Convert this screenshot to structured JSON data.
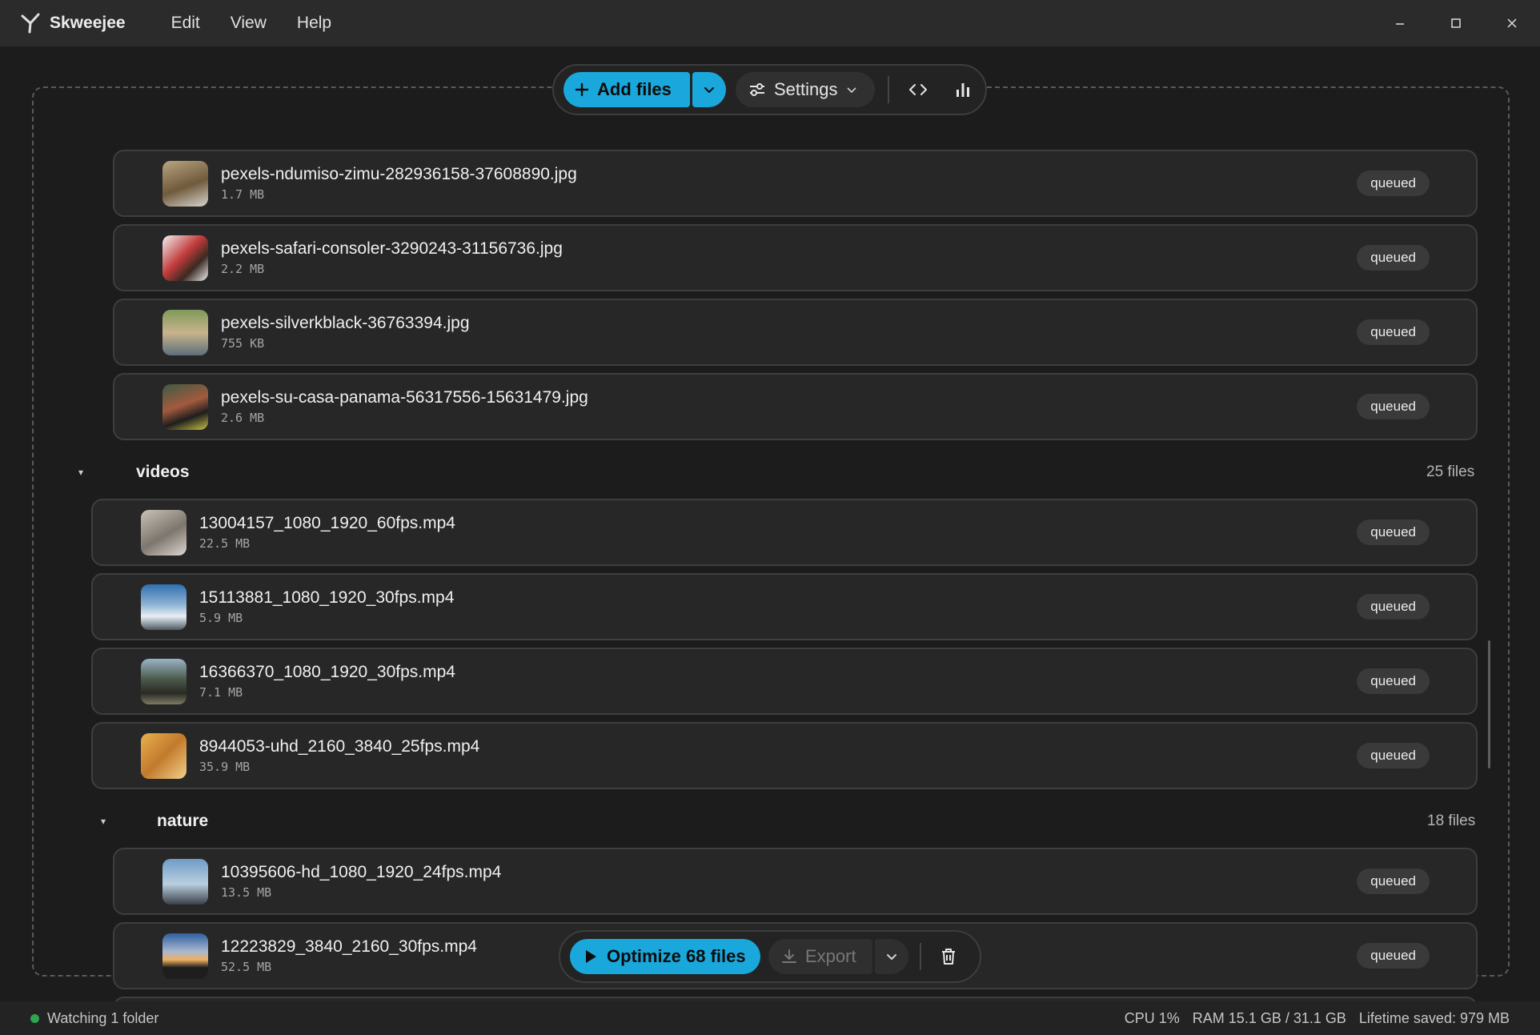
{
  "app": {
    "name": "Skweejee"
  },
  "menu": [
    "Edit",
    "View",
    "Help"
  ],
  "window_controls": {
    "minimize": "–",
    "maximize": "☐",
    "close": "✕"
  },
  "toolbar_top": {
    "add_files": "Add files",
    "settings": "Settings"
  },
  "groups": [
    {
      "name": "",
      "count": "",
      "files": [
        {
          "name": "pexels-ndumiso-zimu-282936158-37608890.jpg",
          "size": "1.7 MB",
          "status": "queued"
        },
        {
          "name": "pexels-safari-consoler-3290243-31156736.jpg",
          "size": "2.2 MB",
          "status": "queued"
        },
        {
          "name": "pexels-silverkblack-36763394.jpg",
          "size": "755 KB",
          "status": "queued"
        },
        {
          "name": "pexels-su-casa-panama-56317556-15631479.jpg",
          "size": "2.6 MB",
          "status": "queued"
        }
      ]
    },
    {
      "name": "videos",
      "count": "25 files",
      "caret": "▾",
      "files": [
        {
          "name": "13004157_1080_1920_60fps.mp4",
          "size": "22.5 MB",
          "status": "queued"
        },
        {
          "name": "15113881_1080_1920_30fps.mp4",
          "size": "5.9 MB",
          "status": "queued"
        },
        {
          "name": "16366370_1080_1920_30fps.mp4",
          "size": "7.1 MB",
          "status": "queued"
        },
        {
          "name": "8944053-uhd_2160_3840_25fps.mp4",
          "size": "35.9 MB",
          "status": "queued"
        }
      ]
    },
    {
      "name": "nature",
      "count": "18 files",
      "caret": "▾",
      "files": [
        {
          "name": "10395606-hd_1080_1920_24fps.mp4",
          "size": "13.5 MB",
          "status": "queued"
        },
        {
          "name": "12223829_3840_2160_30fps.mp4",
          "size": "52.5 MB",
          "status": "queued"
        }
      ]
    }
  ],
  "toolbar_bottom": {
    "optimize": "Optimize 68 files",
    "export": "Export"
  },
  "statusbar": {
    "watching": "Watching 1 folder",
    "cpu": "CPU 1%",
    "ram": "RAM 15.1 GB / 31.1 GB",
    "lifetime": "Lifetime saved: 979 MB"
  },
  "colors": {
    "accent": "#1aa8dc",
    "status_ok": "#2ea44f"
  }
}
